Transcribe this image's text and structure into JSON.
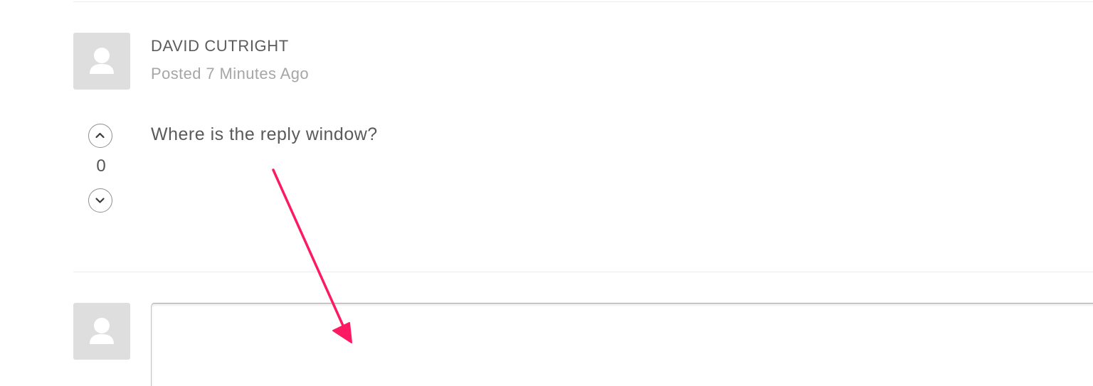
{
  "comment": {
    "author": "DAVID CUTRIGHT",
    "posted": "Posted 7 Minutes Ago",
    "body": "Where is the reply window?",
    "votes": "0",
    "avatar_icon": "user-silhouette-icon"
  },
  "reply": {
    "value": "",
    "placeholder": "",
    "avatar_icon": "user-silhouette-icon"
  },
  "annotation": {
    "arrow_color": "#fc1a63"
  },
  "colors": {
    "avatar_bg": "#dedede",
    "divider": "#ececec",
    "author_text": "#5c5c5c",
    "meta_text": "#a6a6a6"
  }
}
